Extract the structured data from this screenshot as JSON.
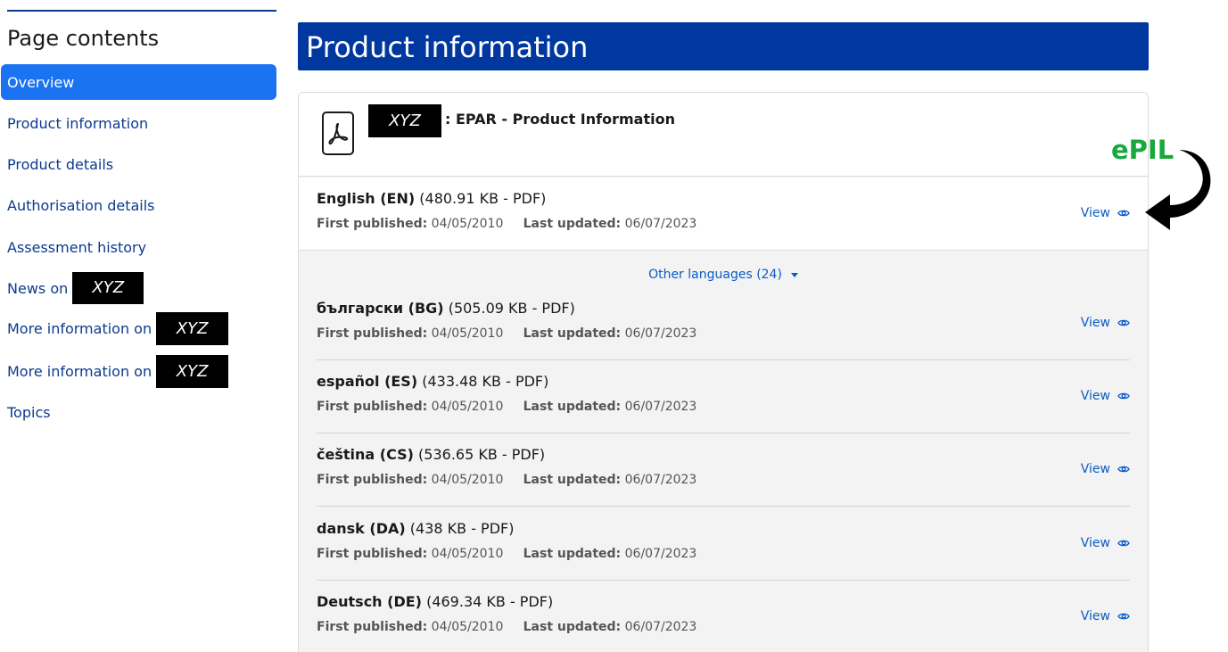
{
  "sidebar": {
    "title": "Page contents",
    "items": [
      {
        "label": "Overview",
        "active": true
      },
      {
        "label": "Product information"
      },
      {
        "label": "Product details"
      },
      {
        "label": "Authorisation details"
      },
      {
        "label": "Assessment history"
      },
      {
        "label": "News on",
        "redacted": "XYZ"
      },
      {
        "label": "More information on",
        "redacted": "XYZ"
      },
      {
        "label": "More information on",
        "redacted": "XYZ"
      },
      {
        "label": "Topics"
      }
    ]
  },
  "main": {
    "title": "Product information",
    "document": {
      "redacted_name": "XYZ",
      "title": ": EPAR - Product Information",
      "icon": "pdf-icon"
    },
    "primary": {
      "lang": "English (EN)",
      "size": "(480.91 KB - PDF)",
      "first_published_label": "First published:",
      "first_published": "04/05/2010",
      "last_updated_label": "Last updated:",
      "last_updated": "06/07/2023",
      "view_label": "View"
    },
    "other_languages_label": "Other languages (24)",
    "languages": [
      {
        "lang": "български (BG)",
        "size": "(505.09 KB - PDF)",
        "first_published": "04/05/2010",
        "last_updated": "06/07/2023",
        "view_label": "View"
      },
      {
        "lang": "español (ES)",
        "size": "(433.48 KB - PDF)",
        "first_published": "04/05/2010",
        "last_updated": "06/07/2023",
        "view_label": "View"
      },
      {
        "lang": "čeština (CS)",
        "size": "(536.65 KB - PDF)",
        "first_published": "04/05/2010",
        "last_updated": "06/07/2023",
        "view_label": "View"
      },
      {
        "lang": "dansk (DA)",
        "size": "(438 KB - PDF)",
        "first_published": "04/05/2010",
        "last_updated": "06/07/2023",
        "view_label": "View"
      },
      {
        "lang": "Deutsch (DE)",
        "size": "(469.34 KB - PDF)",
        "first_published": "04/05/2010",
        "last_updated": "06/07/2023",
        "view_label": "View"
      }
    ]
  },
  "annotation": {
    "label": "ePIL",
    "color": "#18a83c"
  },
  "colors": {
    "header_bg": "#0038a0",
    "active_nav": "#1a73f0",
    "link": "#0b5cc4"
  }
}
